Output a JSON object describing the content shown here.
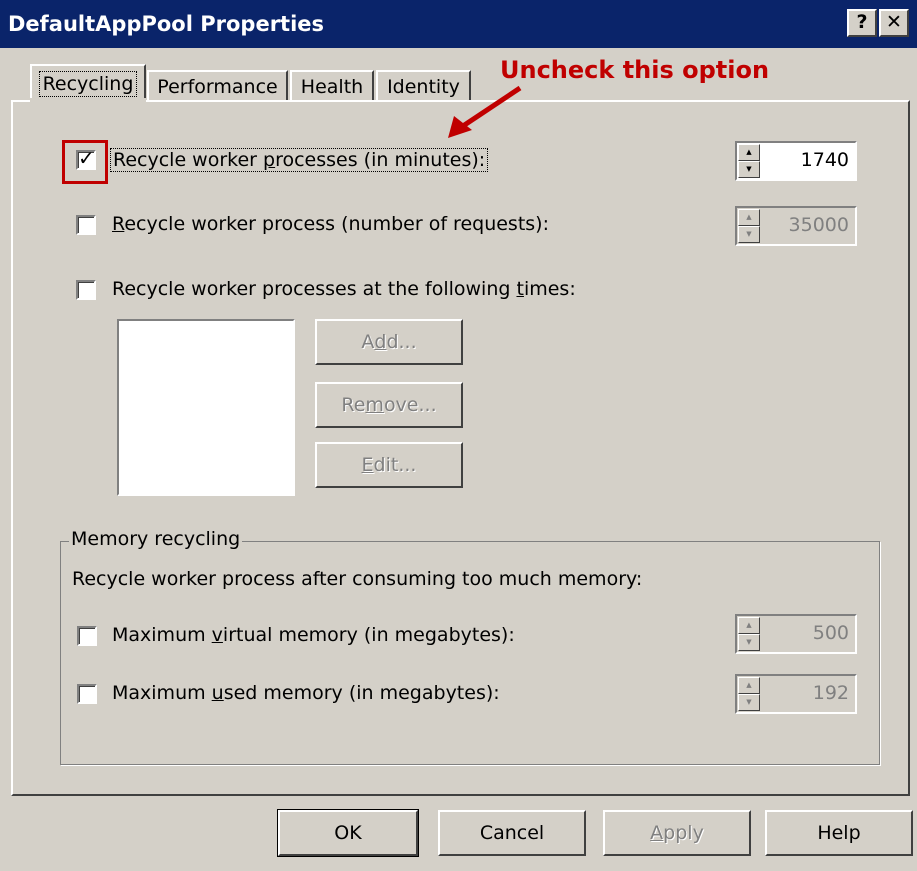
{
  "window": {
    "title": "DefaultAppPool Properties",
    "help_label": "?",
    "close_label": "✕"
  },
  "tabs": [
    {
      "label": "Recycling",
      "active": true
    },
    {
      "label": "Performance",
      "active": false
    },
    {
      "label": "Health",
      "active": false
    },
    {
      "label": "Identity",
      "active": false
    }
  ],
  "annotation": {
    "text": "Uncheck this option",
    "color": "#c00000"
  },
  "recycling": {
    "minutes": {
      "pre": "Recycle worker ",
      "u": "p",
      "post": "rocesses (in minutes):",
      "checked": true,
      "value": "1740"
    },
    "requests": {
      "pre": "",
      "u": "R",
      "post": "ecycle worker process (number of requests):",
      "checked": false,
      "value": "35000"
    },
    "times": {
      "pre": "Recycle worker processes at the following ",
      "u": "t",
      "post": "imes:",
      "checked": false
    },
    "add_button": {
      "pre": "A",
      "u": "d",
      "post": "d..."
    },
    "remove_button": {
      "pre": "Re",
      "u": "m",
      "post": "ove..."
    },
    "edit_button": {
      "pre": "",
      "u": "E",
      "post": "dit..."
    }
  },
  "memory": {
    "group_title": "Memory recycling",
    "description": "Recycle worker process after consuming too much memory:",
    "virtual": {
      "pre": "Maximum ",
      "u": "v",
      "post": "irtual memory (in megabytes):",
      "checked": false,
      "value": "500"
    },
    "used": {
      "pre": "Maximum ",
      "u": "u",
      "post": "sed memory (in megabytes):",
      "checked": false,
      "value": "192"
    }
  },
  "footer": {
    "ok": "OK",
    "cancel": "Cancel",
    "apply": {
      "pre": "",
      "u": "A",
      "post": "pply"
    },
    "help": "Help"
  },
  "colors": {
    "titlebar": "#0a246a",
    "face": "#d4d0c8",
    "annotation": "#c00000"
  }
}
